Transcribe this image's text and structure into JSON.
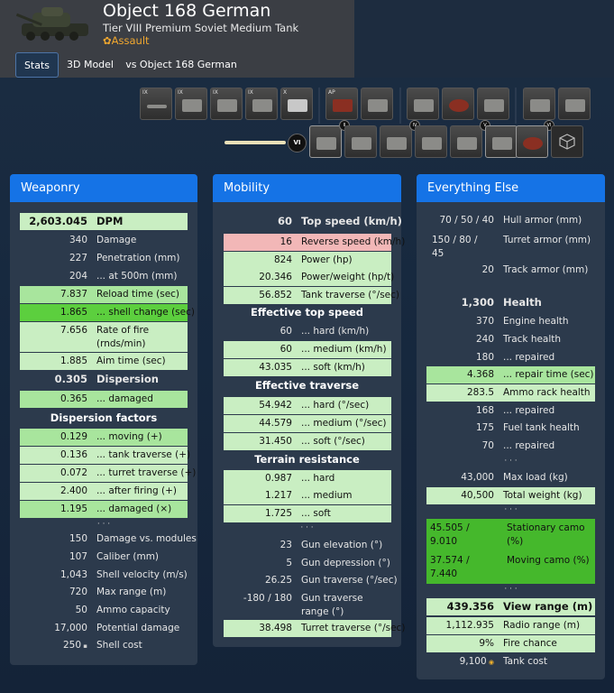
{
  "header": {
    "tank_name": "Object 168 German",
    "subtitle": "Tier VIII Premium Soviet Medium Tank",
    "role": "Assault",
    "role_icon": "gear-icon"
  },
  "tabs": [
    {
      "label": "Stats",
      "active": true
    },
    {
      "label": "3D Model",
      "active": false
    },
    {
      "label": "vs Object 168 German",
      "active": false
    }
  ],
  "modules": {
    "tiers": [
      "IX",
      "IX",
      "IX",
      "IX",
      "X"
    ],
    "ammo_tag": "AP",
    "slider_level": "VI",
    "equipment_tiers": [
      "IV",
      "V",
      "VI"
    ]
  },
  "weaponry": {
    "title": "Weaponry",
    "rows": [
      {
        "value": "2,603.045",
        "label": "DPM",
        "style": "bold hl-lg"
      },
      {
        "value": "340",
        "label": "Damage",
        "style": ""
      },
      {
        "value": "227",
        "label": "Penetration (mm)",
        "style": ""
      },
      {
        "value": "204",
        "label": "... at 500m (mm)",
        "style": ""
      },
      {
        "value": "7.837",
        "label": "Reload time (sec)",
        "style": "hl-g"
      },
      {
        "value": "1.865",
        "label": "... shell change (sec)",
        "style": "hl-dg"
      },
      {
        "value": "7.656",
        "label": "Rate of fire (rnds/min)",
        "style": "hl-lg wrap"
      },
      {
        "value": "1.885",
        "label": "Aim time (sec)",
        "style": "hl-lg"
      },
      {
        "value": "0.305",
        "label": "Dispersion",
        "style": "bold"
      },
      {
        "value": "0.365",
        "label": "... damaged",
        "style": "hl-g"
      }
    ],
    "section_label": "Dispersion factors",
    "factor_rows": [
      {
        "value": "0.129",
        "label": "... moving (+)",
        "style": "hl-g"
      },
      {
        "value": "0.136",
        "label": "... tank traverse (+)",
        "style": "hl-lg"
      },
      {
        "value": "0.072",
        "label": "... turret traverse (+)",
        "style": "hl-lg"
      },
      {
        "value": "2.400",
        "label": "... after firing (+)",
        "style": "hl-lg"
      },
      {
        "value": "1.195",
        "label": "... damaged (×)",
        "style": "hl-g"
      }
    ],
    "dots": "· · ·",
    "extra_rows": [
      {
        "value": "150",
        "label": "Damage vs. modules",
        "style": ""
      },
      {
        "value": "107",
        "label": "Caliber (mm)",
        "style": ""
      },
      {
        "value": "1,043",
        "label": "Shell velocity (m/s)",
        "style": ""
      },
      {
        "value": "720",
        "label": "Max range (m)",
        "style": ""
      },
      {
        "value": "50",
        "label": "Ammo capacity",
        "style": ""
      },
      {
        "value": "17,000",
        "label": "Potential damage",
        "style": ""
      },
      {
        "value": "250",
        "label": "Shell cost",
        "style": "",
        "icon": "silver-coin-icon"
      }
    ]
  },
  "mobility": {
    "title": "Mobility",
    "rows": [
      {
        "value": "60",
        "label": "Top speed (km/h)",
        "style": "bold"
      },
      {
        "value": "16",
        "label": "Reverse speed (km/h)",
        "style": "hl-r"
      },
      {
        "value": "824",
        "label": "Power (hp)",
        "style": "hl-lg"
      },
      {
        "value": "20.346",
        "label": "Power/weight (hp/t)",
        "style": "hl-lg"
      },
      {
        "value": "56.852",
        "label": "Tank traverse (°/sec)",
        "style": "hl-lg"
      }
    ],
    "sections": [
      {
        "title": "Effective top speed",
        "rows": [
          {
            "value": "60",
            "label": "... hard (km/h)",
            "style": ""
          },
          {
            "value": "60",
            "label": "... medium (km/h)",
            "style": "hl-lg"
          },
          {
            "value": "43.035",
            "label": "... soft (km/h)",
            "style": "hl-lg"
          }
        ]
      },
      {
        "title": "Effective traverse",
        "rows": [
          {
            "value": "54.942",
            "label": "... hard (°/sec)",
            "style": "hl-lg"
          },
          {
            "value": "44.579",
            "label": "... medium (°/sec)",
            "style": "hl-lg"
          },
          {
            "value": "31.450",
            "label": "... soft (°/sec)",
            "style": "hl-lg"
          }
        ]
      },
      {
        "title": "Terrain resistance",
        "rows": [
          {
            "value": "0.987",
            "label": "... hard",
            "style": "hl-lg"
          },
          {
            "value": "1.217",
            "label": "... medium",
            "style": "hl-lg"
          },
          {
            "value": "1.725",
            "label": "... soft",
            "style": "hl-lg"
          }
        ]
      }
    ],
    "dots": "· · ·",
    "extra_rows": [
      {
        "value": "23",
        "label": "Gun elevation (°)",
        "style": ""
      },
      {
        "value": "5",
        "label": "Gun depression (°)",
        "style": ""
      },
      {
        "value": "26.25",
        "label": "Gun traverse (°/sec)",
        "style": ""
      },
      {
        "value": "-180 / 180",
        "label": "Gun traverse range (°)",
        "style": "wrap"
      },
      {
        "value": "38.498",
        "label": "Turret traverse (°/sec)",
        "style": "hl-lg"
      }
    ]
  },
  "everything_else": {
    "title": "Everything Else",
    "hull_armor": {
      "value": "70 / 50 / 40",
      "label": "Hull armor (mm)"
    },
    "turret_armor": {
      "value_line1": "150 / 80 /",
      "value_line2": "45",
      "label": "Turret armor (mm)"
    },
    "track_armor": {
      "value": "20",
      "label": "Track armor (mm)"
    },
    "rows": [
      {
        "value": "1,300",
        "label": "Health",
        "style": "bold"
      },
      {
        "value": "370",
        "label": "Engine health",
        "style": ""
      },
      {
        "value": "240",
        "label": "Track health",
        "style": ""
      },
      {
        "value": "180",
        "label": "... repaired",
        "style": ""
      },
      {
        "value": "4.368",
        "label": "... repair time (sec)",
        "style": "hl-g"
      },
      {
        "value": "283.5",
        "label": "Ammo rack health",
        "style": "hl-lg"
      },
      {
        "value": "168",
        "label": "... repaired",
        "style": ""
      },
      {
        "value": "175",
        "label": "Fuel tank health",
        "style": ""
      },
      {
        "value": "70",
        "label": "... repaired",
        "style": ""
      }
    ],
    "dots": "· · ·",
    "load_rows": [
      {
        "value": "43,000",
        "label": "Max load (kg)",
        "style": ""
      },
      {
        "value": "40,500",
        "label": "Total weight (kg)",
        "style": "hl-lg"
      }
    ],
    "camo": [
      {
        "value_line1": "45.505 /",
        "value_line2": "9.010",
        "label": "Stationary camo (%)"
      },
      {
        "value_line1": "37.574 /",
        "value_line2": "7.440",
        "label": "Moving camo (%)"
      }
    ],
    "final_rows": [
      {
        "value": "439.356",
        "label": "View range (m)",
        "style": "bold hl-lg"
      },
      {
        "value": "1,112.935",
        "label": "Radio range (m)",
        "style": "hl-lg"
      },
      {
        "value": "9%",
        "label": "Fire chance",
        "style": "hl-lg"
      },
      {
        "value": "9,100",
        "label": "Tank cost",
        "style": "",
        "icon": "gold-coin-icon"
      }
    ]
  },
  "colors": {
    "accent_blue": "#1573e6",
    "panel_bg": "#2c3a4c",
    "highlight_light_green": "#c9eec2",
    "highlight_green": "#a8e59d",
    "highlight_dark_green": "#5ccf3e",
    "highlight_red": "#f2b7b7",
    "role_orange": "#f0a72f"
  }
}
